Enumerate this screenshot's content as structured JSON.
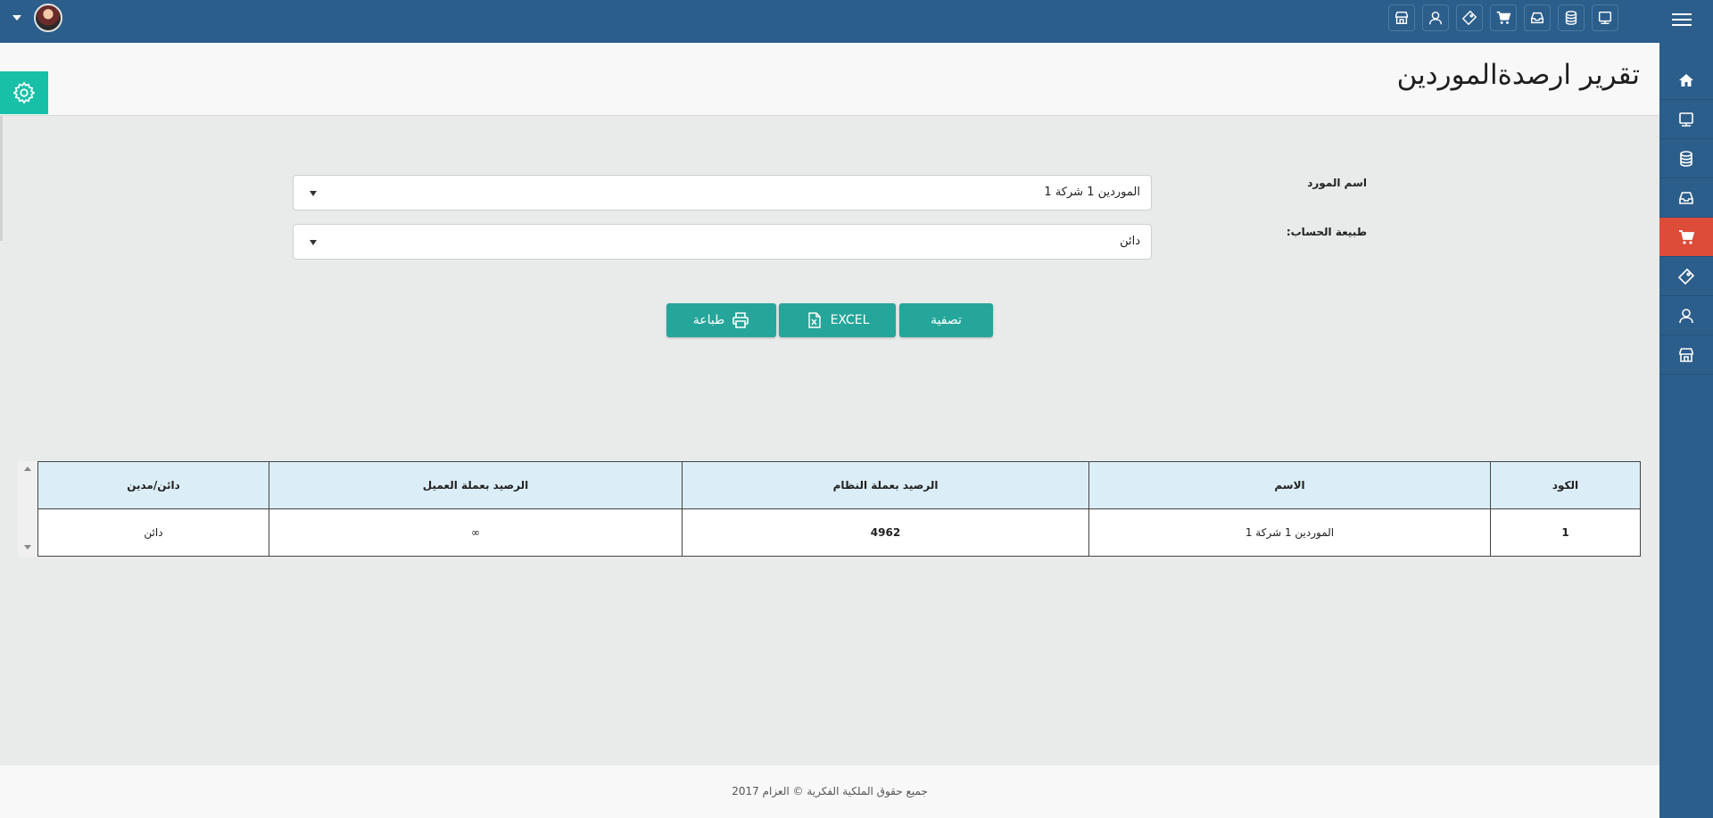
{
  "header": {
    "page_title": "تقرير ارصدةالموردين"
  },
  "topbar": {
    "icons": [
      "monitor-icon",
      "database-icon",
      "inbox-icon",
      "cart-icon",
      "ticket-icon",
      "user-icon",
      "store-icon"
    ]
  },
  "sidebar": {
    "items": [
      "home-icon",
      "monitor-icon",
      "database-icon",
      "inbox-icon",
      "cart-icon",
      "ticket-icon",
      "user-icon",
      "store-icon"
    ],
    "active_index": 4,
    "active_color": "#dd4b39"
  },
  "form": {
    "supplier_label": "اسم المورد",
    "supplier_value": "الموردين 1  شركة 1",
    "account_type_label": "طبيعة الحساب:",
    "account_type_value": "دائن"
  },
  "buttons": {
    "filter_label": "تصفية",
    "excel_label": "EXCEL",
    "print_label": "طباعة"
  },
  "table": {
    "headers": [
      "الكود",
      "الاسم",
      "الرصيد بعملة النظام",
      "الرصيد بعملة العميل",
      "دائن/مدين"
    ],
    "rows": [
      [
        "1",
        "الموردين 1 شركة 1",
        "4962",
        "∞",
        "دائن"
      ]
    ]
  },
  "footer": {
    "text": "جميع حقوق الملكية الفكرية © العزام 2017"
  },
  "colors": {
    "primary": "#2c5e8b",
    "button": "#26a69a",
    "settings_button": "#17c0a7"
  }
}
